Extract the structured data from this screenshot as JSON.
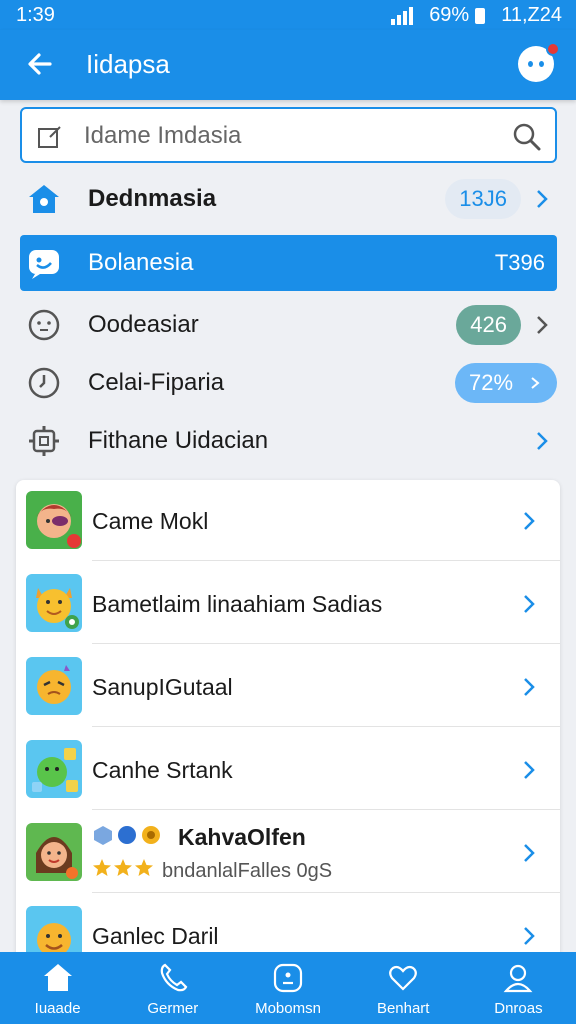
{
  "status": {
    "time": "1:39",
    "battery": "69%",
    "clock": "11,Z24"
  },
  "appbar": {
    "title": "Iidapsa"
  },
  "search": {
    "placeholder": "Idame Imdasia"
  },
  "menu": [
    {
      "label": "Dednmasia",
      "badge": "13J6",
      "style": "bold"
    },
    {
      "label": "Bolanesia",
      "value": "T396",
      "style": "active"
    },
    {
      "label": "Oodeasiar",
      "badge": "426"
    },
    {
      "label": "Celai-Fiparia",
      "badge": "72%"
    },
    {
      "label": "Fithane Uidacian"
    }
  ],
  "list": [
    {
      "name": "Came Mokl"
    },
    {
      "name": "Bametlaim linaahiam Sadias"
    },
    {
      "name": "SanupIGutaal"
    },
    {
      "name": "Canhe Srtank"
    },
    {
      "name": "KahvaOlfen",
      "sub": "bndanlalFalles 0gS"
    },
    {
      "name": "Ganlec Daril"
    }
  ],
  "nav": [
    {
      "label": "Iuaade"
    },
    {
      "label": "Germer"
    },
    {
      "label": "Mobomsn"
    },
    {
      "label": "Benhart"
    },
    {
      "label": "Dnroas"
    }
  ],
  "colors": {
    "accent": "#1a8ee8",
    "badge_grey": "#e3eaf3",
    "badge_green": "#6aa89a",
    "badge_blue": "#6cb7f7"
  }
}
